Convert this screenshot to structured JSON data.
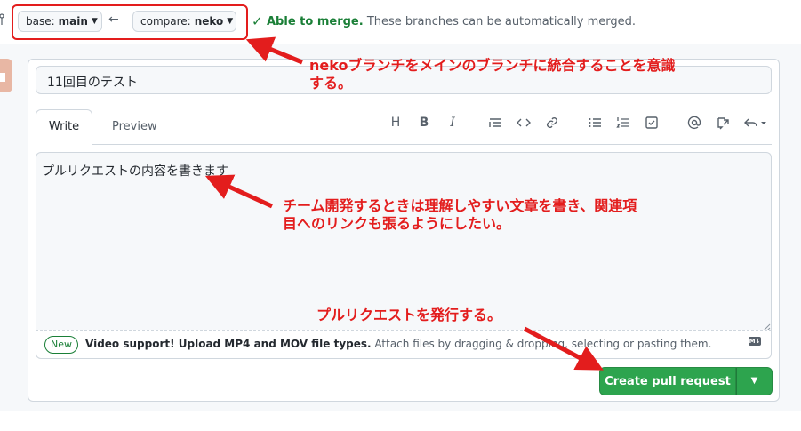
{
  "compare_bar": {
    "base_label": "base:",
    "base_value": "main",
    "compare_label": "compare:",
    "compare_value": "neko",
    "merge_status_strong": "Able to merge.",
    "merge_status_text": "These branches can be automatically merged."
  },
  "form": {
    "title_value": "11回目のテスト",
    "tabs": [
      "Write",
      "Preview"
    ],
    "body_value": "プルリクエストの内容を書きます",
    "attach": {
      "badge": "New",
      "strong": "Video support! Upload MP4 and MOV file types.",
      "text": "Attach files by dragging & dropping, selecting or pasting them."
    },
    "toolbar_icons": [
      "heading-icon",
      "bold-icon",
      "italic-icon",
      "quote-icon",
      "code-icon",
      "link-icon",
      "unordered-list-icon",
      "ordered-list-icon",
      "task-list-icon",
      "mention-icon",
      "reference-icon",
      "undo-icon"
    ]
  },
  "actions": {
    "create_label": "Create pull request"
  },
  "annotations": {
    "note1": "nekoブランチをメインのブランチに統合することを意識する。",
    "note2": "チーム開発するときは理解しやすい文章を書き、関連項目へのリンクも張るようにしたい。",
    "note3": "プルリクエストを発行する。"
  },
  "colors": {
    "accent_green": "#2da44e",
    "annotation_red": "#e31d1d"
  }
}
